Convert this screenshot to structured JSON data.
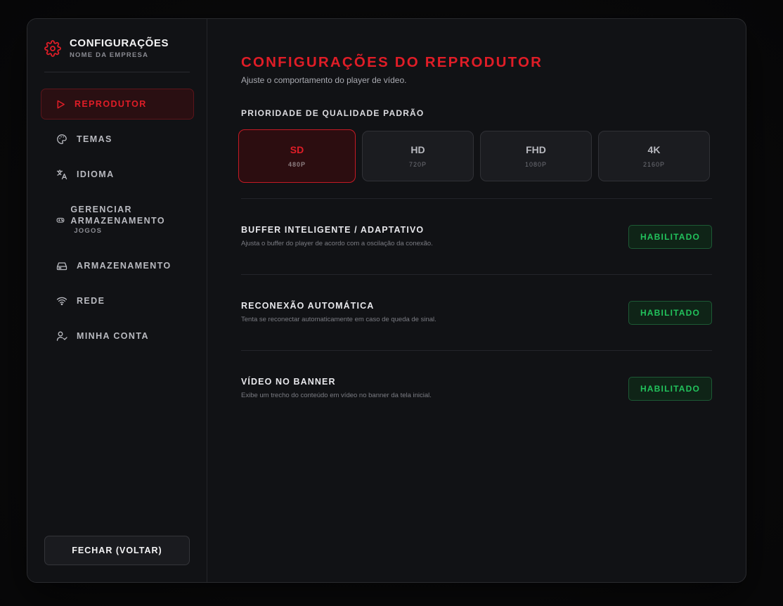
{
  "brand": {
    "title": "CONFIGURAÇÕES",
    "subtitle": "NOME DA EMPRESA",
    "accent_color": "#e01d27"
  },
  "sidebar": {
    "items": [
      {
        "id": "player",
        "label": "REPRODUTOR",
        "icon": "play-icon",
        "active": true
      },
      {
        "id": "themes",
        "label": "TEMAS",
        "icon": "palette-icon",
        "active": false
      },
      {
        "id": "language",
        "label": "IDIOMA",
        "icon": "translate-icon",
        "active": false
      },
      {
        "id": "games-storage",
        "label": "GERENCIAR ARMAZENAMENTO",
        "sublabel": "JOGOS",
        "icon": "gamepad-icon",
        "active": false
      },
      {
        "id": "storage",
        "label": "ARMAZENAMENTO",
        "icon": "hard-drive-icon",
        "active": false
      },
      {
        "id": "network",
        "label": "REDE",
        "icon": "wifi-icon",
        "active": false
      },
      {
        "id": "account",
        "label": "MINHA CONTA",
        "icon": "user-check-icon",
        "active": false
      }
    ],
    "close_button": "FECHAR (VOLTAR)"
  },
  "main": {
    "title": "CONFIGURAÇÕES DO REPRODUTOR",
    "subtitle": "Ajuste o comportamento do player de vídeo.",
    "quality": {
      "label": "PRIORIDADE DE QUALIDADE PADRÃO",
      "options": [
        {
          "name": "SD",
          "resolution": "480P",
          "selected": true
        },
        {
          "name": "HD",
          "resolution": "720P",
          "selected": false
        },
        {
          "name": "FHD",
          "resolution": "1080P",
          "selected": false
        },
        {
          "name": "4K",
          "resolution": "2160P",
          "selected": false
        }
      ]
    },
    "settings": [
      {
        "title": "BUFFER INTELIGENTE / ADAPTATIVO",
        "description": "Ajusta o buffer do player de acordo com a oscilação da conexão.",
        "status": "HABILITADO"
      },
      {
        "title": "RECONEXÃO AUTOMÁTICA",
        "description": "Tenta se reconectar automaticamente em caso de queda de sinal.",
        "status": "HABILITADO"
      },
      {
        "title": "VÍDEO NO BANNER",
        "description": "Exibe um trecho do conteúdo em vídeo no banner da tela inicial.",
        "status": "HABILITADO"
      }
    ]
  },
  "colors": {
    "enabled": "#22c25c",
    "background": "#111215"
  }
}
